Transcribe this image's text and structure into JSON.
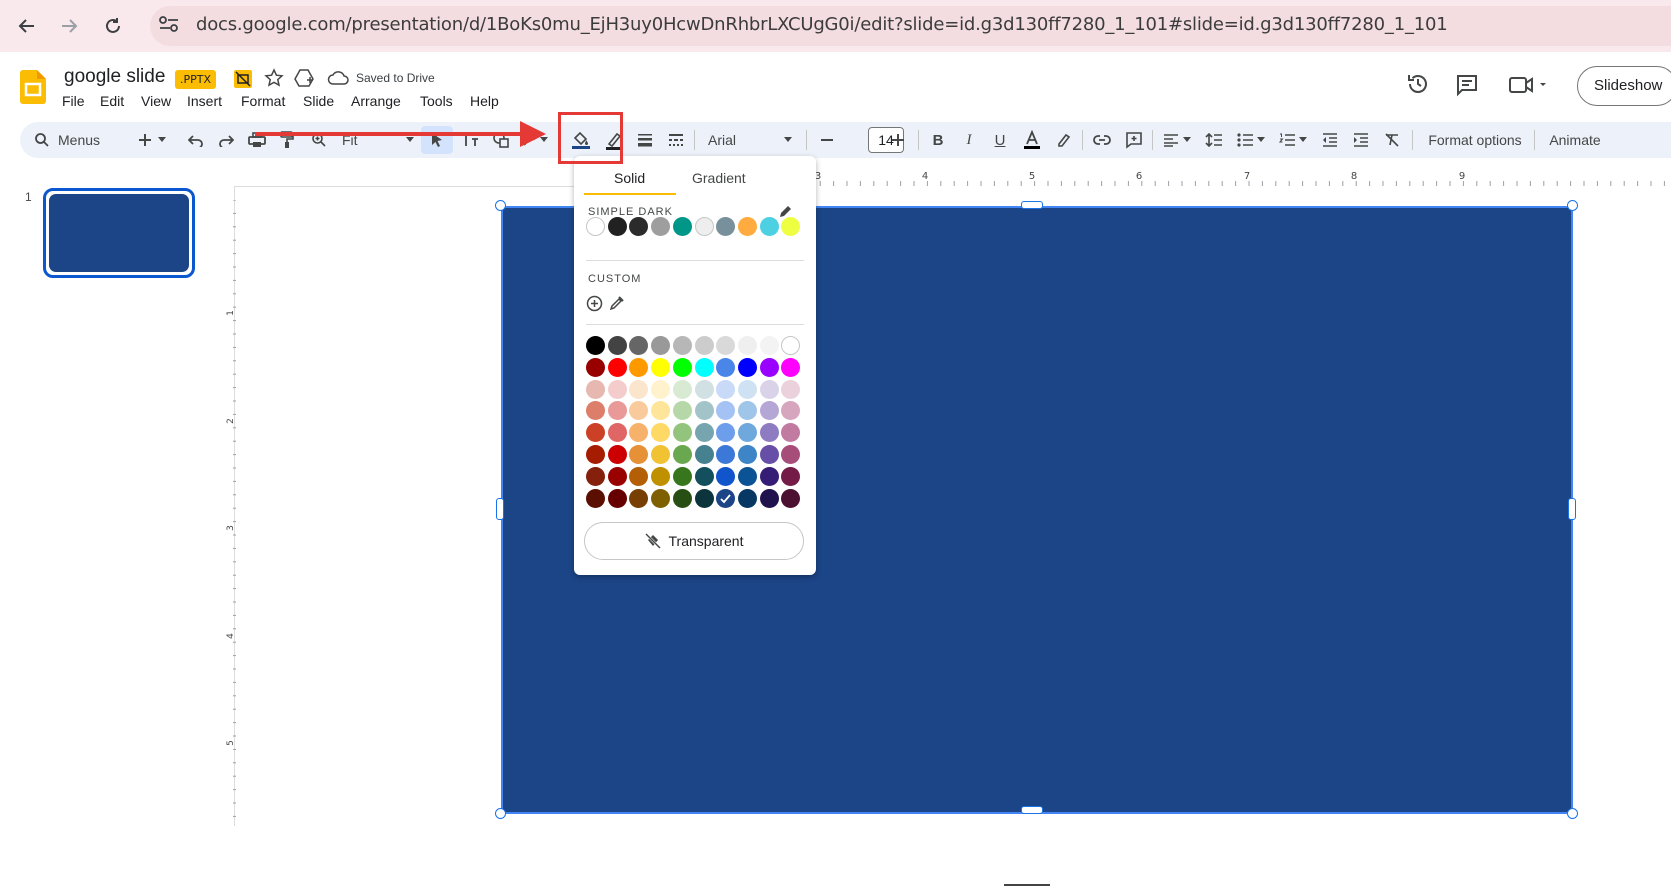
{
  "browser": {
    "url": "docs.google.com/presentation/d/1BoKs0mu_EjH3uy0HcwDnRhbrLXCUgG0i/edit?slide=id.g3d130ff7280_1_101#slide=id.g3d130ff7280_1_101"
  },
  "header": {
    "doc_title": "google slide",
    "badge": ".PPTX",
    "saved_status": "Saved to Drive",
    "slideshow_label": "Slideshow",
    "menus": [
      "File",
      "Edit",
      "View",
      "Insert",
      "Format",
      "Slide",
      "Arrange",
      "Tools",
      "Help"
    ]
  },
  "toolbar": {
    "menus_label": "Menus",
    "zoom_label": "Fit",
    "font_label": "Arial",
    "font_size": "14",
    "format_options_label": "Format options",
    "animate_label": "Animate",
    "icons": [
      "add-icon",
      "undo-icon",
      "redo-icon",
      "print-icon",
      "paint-format-icon",
      "zoom-icon",
      "select-icon",
      "textbox-icon",
      "shape-icon",
      "line-icon",
      "fill-color-icon",
      "border-color-icon",
      "border-weight-icon",
      "border-dash-icon",
      "bold-icon",
      "italic-icon",
      "underline-icon",
      "text-color-icon",
      "highlight-icon",
      "link-icon",
      "comment-icon",
      "align-icon",
      "line-spacing-icon",
      "bullet-list-icon",
      "numbered-list-icon",
      "decrease-indent-icon",
      "increase-indent-icon",
      "clear-format-icon"
    ]
  },
  "filmstrip": {
    "slide_number": "1"
  },
  "rulers": {
    "horizontal": [
      "3",
      "4",
      "5",
      "6",
      "7",
      "8",
      "9"
    ],
    "vertical": [
      "1",
      "2",
      "3",
      "4",
      "5"
    ]
  },
  "fill_popup": {
    "tab_solid": "Solid",
    "tab_gradient": "Gradient",
    "theme_label": "SIMPLE DARK",
    "custom_label": "CUSTOM",
    "transparent_label": "Transparent",
    "selected_color": "#1c4587",
    "theme_colors": [
      "#ffffff",
      "#212121",
      "#2b2b2b",
      "#9e9e9e",
      "#009688",
      "#eeeeee",
      "#78909c",
      "#ffab40",
      "#4dd0e1",
      "#eeff41"
    ],
    "palette": [
      [
        "#000000",
        "#434343",
        "#666666",
        "#999999",
        "#b7b7b7",
        "#cccccc",
        "#d9d9d9",
        "#efefef",
        "#f3f3f3",
        "#ffffff"
      ],
      [
        "#980000",
        "#ff0000",
        "#ff9900",
        "#ffff00",
        "#00ff00",
        "#00ffff",
        "#4a86e8",
        "#0000ff",
        "#9900ff",
        "#ff00ff"
      ],
      [
        "#e6b8af",
        "#f4cccc",
        "#fce5cd",
        "#fff2cc",
        "#d9ead3",
        "#d0e0e3",
        "#c9daf8",
        "#cfe2f3",
        "#d9d2e9",
        "#ead1dc"
      ],
      [
        "#dd7e6b",
        "#ea9999",
        "#f9cb9c",
        "#ffe599",
        "#b6d7a8",
        "#a2c4c9",
        "#a4c2f4",
        "#9fc5e8",
        "#b4a7d6",
        "#d5a6bd"
      ],
      [
        "#cc4125",
        "#e06666",
        "#f6b26b",
        "#ffd966",
        "#93c47d",
        "#76a5af",
        "#6d9eeb",
        "#6fa8dc",
        "#8e7cc3",
        "#c27ba0"
      ],
      [
        "#a61c00",
        "#cc0000",
        "#e69138",
        "#f1c232",
        "#6aa84f",
        "#45818e",
        "#3c78d8",
        "#3d85c6",
        "#674ea7",
        "#a64d79"
      ],
      [
        "#85200c",
        "#990000",
        "#b45f06",
        "#bf9000",
        "#38761d",
        "#134f5c",
        "#1155cc",
        "#0b5394",
        "#351c75",
        "#741b47"
      ],
      [
        "#5b0f00",
        "#660000",
        "#783f04",
        "#7f6000",
        "#274e13",
        "#0c343d",
        "#1c4587",
        "#073763",
        "#20124d",
        "#4c1130"
      ]
    ]
  },
  "slide": {
    "shape_color": "#1c4587"
  }
}
